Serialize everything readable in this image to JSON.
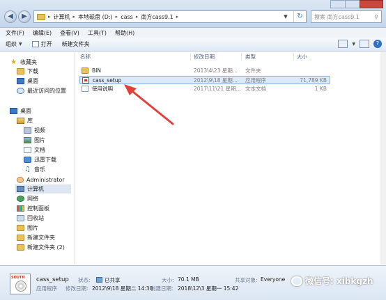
{
  "address_bar": {
    "breadcrumbs": [
      "计算机",
      "本地磁盘 (D:)",
      "cass",
      "南方cass9.1"
    ],
    "search_placeholder": "搜索 南方cass9.1"
  },
  "menu": [
    "文件(F)",
    "编辑(E)",
    "查看(V)",
    "工具(T)",
    "帮助(H)"
  ],
  "toolbar": {
    "organize_label": "组织",
    "open_label": "打开",
    "new_folder_label": "新建文件夹"
  },
  "sidebar": {
    "favorites": {
      "label": "收藏夹",
      "items": [
        "下载",
        "桌面",
        "最近访问的位置"
      ]
    },
    "desktop": "桌面",
    "library": {
      "label": "库",
      "items": [
        "视频",
        "图片",
        "文档",
        "迅雷下载",
        "音乐"
      ]
    },
    "others": [
      "Administrator",
      "计算机",
      "网络",
      "控制面板",
      "回收站",
      "图片",
      "新建文件夹",
      "新建文件夹 (2)"
    ]
  },
  "columns": {
    "name": "名称",
    "modified": "修改日期",
    "type": "类型",
    "size": "大小"
  },
  "files": [
    {
      "name": "BIN",
      "modified": "2013\\4\\23 星期...",
      "type": "文件夹",
      "size": ""
    },
    {
      "name": "cass_setup",
      "modified": "2012\\9\\18 星期...",
      "type": "应用程序",
      "size": "71,789 KB"
    },
    {
      "name": "使用说明",
      "modified": "2017\\11\\21 星期...",
      "type": "文本文档",
      "size": "1 KB"
    }
  ],
  "selected_file_index": 1,
  "details": {
    "name": "cass_setup",
    "type": "应用程序",
    "status_key": "状态:",
    "status_value": "已共享",
    "modified_key": "修改日期:",
    "modified_value": "2012\\9\\18 星期二 14:38",
    "size_key": "大小:",
    "size_value": "70.1 MB",
    "created_key": "创建日期:",
    "created_value": "2018\\12\\3 星期一 15:42",
    "shared_with_key": "共享对象:",
    "shared_with_value": "Everyone",
    "thumb_text": "SOUTH"
  },
  "watermark": "微信号: xibkgzh",
  "colors": {
    "arrow": "#e0413a",
    "selection": "#dbe9f9",
    "folder": "#e9c25b"
  }
}
